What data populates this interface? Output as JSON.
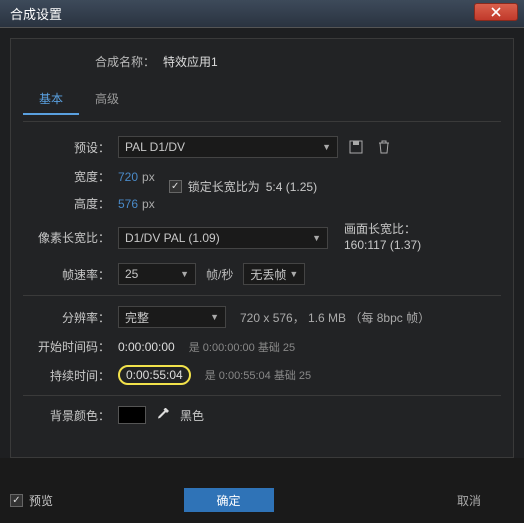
{
  "window": {
    "title": "合成设置"
  },
  "comp": {
    "name_label": "合成名称：",
    "name": "特效应用1"
  },
  "tabs": {
    "basic": "基本",
    "advanced": "高级"
  },
  "preset": {
    "label": "预设：",
    "value": "PAL D1/DV"
  },
  "width": {
    "label": "宽度：",
    "value": "720",
    "unit": "px"
  },
  "height": {
    "label": "高度：",
    "value": "576",
    "unit": "px"
  },
  "lock": {
    "label": "锁定长宽比为",
    "ratio": "5:4 (1.25)"
  },
  "par": {
    "label": "像素长宽比：",
    "value": "D1/DV PAL (1.09)"
  },
  "frame_aspect": {
    "label": "画面长宽比：",
    "value": "160:117 (1.37)"
  },
  "fps": {
    "label": "帧速率：",
    "value": "25",
    "unit": "帧/秒",
    "drop": "无丢帧"
  },
  "resolution": {
    "label": "分辨率：",
    "value": "完整",
    "info": "720 x 576， 1.6 MB （每  8bpc 帧）"
  },
  "start": {
    "label": "开始时间码：",
    "value": "0:00:00:00",
    "note": "是 0:00:00:00  基础 25"
  },
  "duration": {
    "label": "持续时间：",
    "value": "0:00:55:04",
    "note": "是 0:00:55:04  基础 25"
  },
  "bg": {
    "label": "背景颜色：",
    "name": "黑色"
  },
  "footer": {
    "preview": "预览",
    "ok": "确定",
    "cancel": "取消"
  }
}
